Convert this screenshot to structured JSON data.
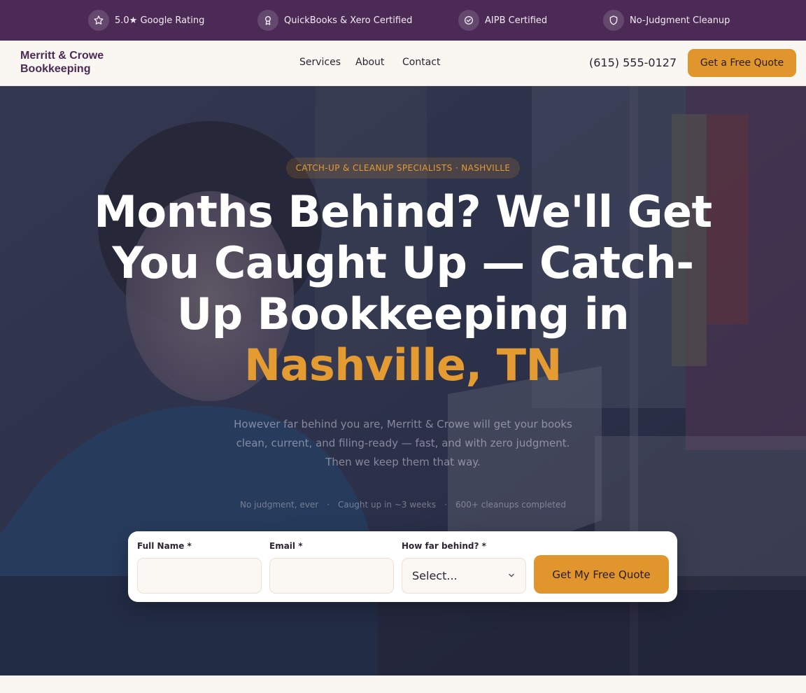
{
  "trust_bar": {
    "items": [
      {
        "icon": "star-icon",
        "label": "5.0★ Google Rating"
      },
      {
        "icon": "award-icon",
        "label": "QuickBooks & Xero Certified"
      },
      {
        "icon": "check-circle-icon",
        "label": "AIPB Certified"
      },
      {
        "icon": "shield-icon",
        "label": "No-Judgment Cleanup"
      }
    ]
  },
  "header": {
    "logo_line1": "Merritt & Crowe",
    "logo_line2": "Bookkeeping",
    "nav": [
      "Services",
      "About",
      "Contact"
    ],
    "phone": "(615) 555-0127",
    "cta_label": "Get a Free Quote"
  },
  "hero": {
    "eyebrow": "CATCH-UP & CLEANUP SPECIALISTS · NASHVILLE",
    "headline_main": "Months Behind? We'll Get You Caught Up — Catch-Up Bookkeeping in ",
    "headline_accent": "Nashville, TN",
    "subtext": "However far behind you are, Merritt & Crowe will get your books clean, current, and filing-ready — fast, and with zero judgment. Then we keep them that way.",
    "points": [
      "No judgment, ever",
      "Caught up in ~3 weeks",
      "600+ cleanups completed"
    ],
    "point_separator": "·"
  },
  "form": {
    "name_label": "Full Name *",
    "name_value": "",
    "email_label": "Email *",
    "email_value": "",
    "behind_label": "How far behind? *",
    "behind_selected": "Select...",
    "submit_label": "Get My Free Quote"
  },
  "colors": {
    "brand_purple": "#4b2a55",
    "accent_orange": "#e0962c",
    "background_cream": "#faf6f1"
  }
}
